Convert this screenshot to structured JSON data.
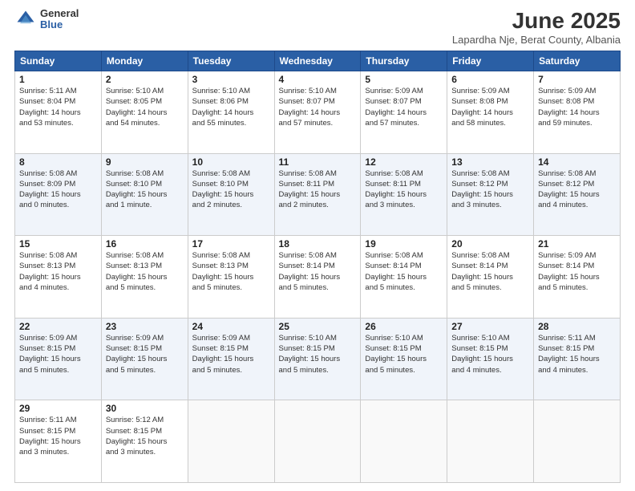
{
  "logo": {
    "general": "General",
    "blue": "Blue"
  },
  "title": "June 2025",
  "subtitle": "Lapardha Nje, Berat County, Albania",
  "header_days": [
    "Sunday",
    "Monday",
    "Tuesday",
    "Wednesday",
    "Thursday",
    "Friday",
    "Saturday"
  ],
  "weeks": [
    [
      {
        "day": "1",
        "info": "Sunrise: 5:11 AM\nSunset: 8:04 PM\nDaylight: 14 hours\nand 53 minutes."
      },
      {
        "day": "2",
        "info": "Sunrise: 5:10 AM\nSunset: 8:05 PM\nDaylight: 14 hours\nand 54 minutes."
      },
      {
        "day": "3",
        "info": "Sunrise: 5:10 AM\nSunset: 8:06 PM\nDaylight: 14 hours\nand 55 minutes."
      },
      {
        "day": "4",
        "info": "Sunrise: 5:10 AM\nSunset: 8:07 PM\nDaylight: 14 hours\nand 57 minutes."
      },
      {
        "day": "5",
        "info": "Sunrise: 5:09 AM\nSunset: 8:07 PM\nDaylight: 14 hours\nand 57 minutes."
      },
      {
        "day": "6",
        "info": "Sunrise: 5:09 AM\nSunset: 8:08 PM\nDaylight: 14 hours\nand 58 minutes."
      },
      {
        "day": "7",
        "info": "Sunrise: 5:09 AM\nSunset: 8:08 PM\nDaylight: 14 hours\nand 59 minutes."
      }
    ],
    [
      {
        "day": "8",
        "info": "Sunrise: 5:08 AM\nSunset: 8:09 PM\nDaylight: 15 hours\nand 0 minutes."
      },
      {
        "day": "9",
        "info": "Sunrise: 5:08 AM\nSunset: 8:10 PM\nDaylight: 15 hours\nand 1 minute."
      },
      {
        "day": "10",
        "info": "Sunrise: 5:08 AM\nSunset: 8:10 PM\nDaylight: 15 hours\nand 2 minutes."
      },
      {
        "day": "11",
        "info": "Sunrise: 5:08 AM\nSunset: 8:11 PM\nDaylight: 15 hours\nand 2 minutes."
      },
      {
        "day": "12",
        "info": "Sunrise: 5:08 AM\nSunset: 8:11 PM\nDaylight: 15 hours\nand 3 minutes."
      },
      {
        "day": "13",
        "info": "Sunrise: 5:08 AM\nSunset: 8:12 PM\nDaylight: 15 hours\nand 3 minutes."
      },
      {
        "day": "14",
        "info": "Sunrise: 5:08 AM\nSunset: 8:12 PM\nDaylight: 15 hours\nand 4 minutes."
      }
    ],
    [
      {
        "day": "15",
        "info": "Sunrise: 5:08 AM\nSunset: 8:13 PM\nDaylight: 15 hours\nand 4 minutes."
      },
      {
        "day": "16",
        "info": "Sunrise: 5:08 AM\nSunset: 8:13 PM\nDaylight: 15 hours\nand 5 minutes."
      },
      {
        "day": "17",
        "info": "Sunrise: 5:08 AM\nSunset: 8:13 PM\nDaylight: 15 hours\nand 5 minutes."
      },
      {
        "day": "18",
        "info": "Sunrise: 5:08 AM\nSunset: 8:14 PM\nDaylight: 15 hours\nand 5 minutes."
      },
      {
        "day": "19",
        "info": "Sunrise: 5:08 AM\nSunset: 8:14 PM\nDaylight: 15 hours\nand 5 minutes."
      },
      {
        "day": "20",
        "info": "Sunrise: 5:08 AM\nSunset: 8:14 PM\nDaylight: 15 hours\nand 5 minutes."
      },
      {
        "day": "21",
        "info": "Sunrise: 5:09 AM\nSunset: 8:14 PM\nDaylight: 15 hours\nand 5 minutes."
      }
    ],
    [
      {
        "day": "22",
        "info": "Sunrise: 5:09 AM\nSunset: 8:15 PM\nDaylight: 15 hours\nand 5 minutes."
      },
      {
        "day": "23",
        "info": "Sunrise: 5:09 AM\nSunset: 8:15 PM\nDaylight: 15 hours\nand 5 minutes."
      },
      {
        "day": "24",
        "info": "Sunrise: 5:09 AM\nSunset: 8:15 PM\nDaylight: 15 hours\nand 5 minutes."
      },
      {
        "day": "25",
        "info": "Sunrise: 5:10 AM\nSunset: 8:15 PM\nDaylight: 15 hours\nand 5 minutes."
      },
      {
        "day": "26",
        "info": "Sunrise: 5:10 AM\nSunset: 8:15 PM\nDaylight: 15 hours\nand 5 minutes."
      },
      {
        "day": "27",
        "info": "Sunrise: 5:10 AM\nSunset: 8:15 PM\nDaylight: 15 hours\nand 4 minutes."
      },
      {
        "day": "28",
        "info": "Sunrise: 5:11 AM\nSunset: 8:15 PM\nDaylight: 15 hours\nand 4 minutes."
      }
    ],
    [
      {
        "day": "29",
        "info": "Sunrise: 5:11 AM\nSunset: 8:15 PM\nDaylight: 15 hours\nand 3 minutes."
      },
      {
        "day": "30",
        "info": "Sunrise: 5:12 AM\nSunset: 8:15 PM\nDaylight: 15 hours\nand 3 minutes."
      },
      {
        "day": "",
        "info": ""
      },
      {
        "day": "",
        "info": ""
      },
      {
        "day": "",
        "info": ""
      },
      {
        "day": "",
        "info": ""
      },
      {
        "day": "",
        "info": ""
      }
    ]
  ]
}
